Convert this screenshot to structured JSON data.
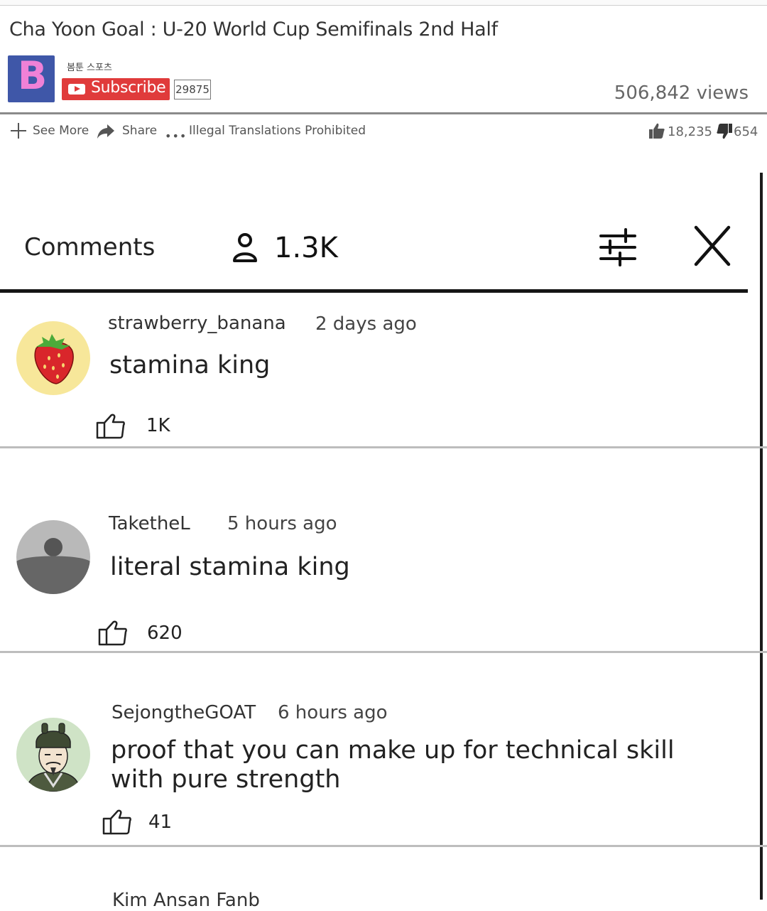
{
  "video": {
    "title": "Cha Yoon Goal : U-20 World Cup Semifinals 2nd Half",
    "views": "506,842 views"
  },
  "channel": {
    "logo_letter": "B",
    "name": "봄툰 스포츠",
    "subscribe_label": "Subscribe",
    "subscriber_count": "29875"
  },
  "actions": {
    "see_more": "See More",
    "share": "Share",
    "notice": "Illegal Translations Prohibited",
    "likes": "18,235",
    "dislikes": "654"
  },
  "comments_panel": {
    "title": "Comments",
    "count": "1.3K"
  },
  "comments": [
    {
      "author": "strawberry_banana",
      "time": "2 days ago",
      "text": "stamina king",
      "likes": "1K"
    },
    {
      "author": "TaketheL",
      "time": "5 hours ago",
      "text": "literal stamina king",
      "likes": "620"
    },
    {
      "author": "SejongtheGOAT",
      "time": "6 hours ago",
      "text": "proof that you can make up for technical skill with pure strength",
      "likes": "41"
    }
  ],
  "partial_comment_author": "Kim Ansan Fanb",
  "icons": {
    "subscribe": "play-icon",
    "see_more": "plus-icon",
    "share": "share-arrow-icon",
    "more": "more-dots-icon",
    "like": "thumbs-up-icon",
    "dislike": "thumbs-down-icon",
    "user": "user-icon",
    "filter": "sliders-icon",
    "close": "close-x-icon"
  },
  "colors": {
    "subscribe_red": "#e03b3b",
    "logo_blue": "#3f57a8",
    "logo_pink": "#f081d7"
  }
}
